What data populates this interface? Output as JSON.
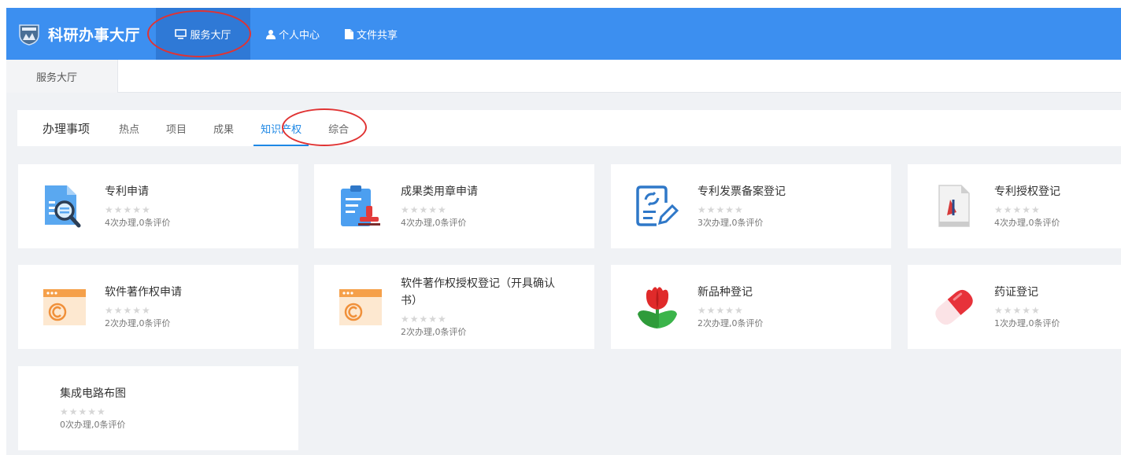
{
  "header": {
    "title": "科研办事大厅",
    "nav": [
      {
        "label": "服务大厅"
      },
      {
        "label": "个人中心"
      },
      {
        "label": "文件共享"
      }
    ]
  },
  "page_tab": {
    "label": "服务大厅"
  },
  "filter": {
    "heading": "办理事项",
    "items": [
      {
        "label": "热点"
      },
      {
        "label": "项目"
      },
      {
        "label": "成果"
      },
      {
        "label": "知识产权",
        "active": true
      },
      {
        "label": "综合"
      }
    ]
  },
  "cards": [
    {
      "title": "专利申请",
      "stats": "4次办理,0条评价",
      "rating": 0,
      "icon": "patent-search-icon"
    },
    {
      "title": "成果类用章申请",
      "stats": "4次办理,0条评价",
      "rating": 0,
      "icon": "clipboard-stamp-icon"
    },
    {
      "title": "专利发票备案登记",
      "stats": "3次办理,0条评价",
      "rating": 0,
      "icon": "invoice-edit-icon"
    },
    {
      "title": "专利授权登记",
      "stats": "4次办理,0条评价",
      "rating": 0,
      "icon": "pdf-document-icon"
    },
    {
      "title": "软件著作权申请",
      "stats": "2次办理,0条评价",
      "rating": 0,
      "icon": "copyright-window-icon"
    },
    {
      "title": "软件著作权授权登记（开具确认书）",
      "stats": "2次办理,0条评价",
      "rating": 0,
      "icon": "copyright-window-icon"
    },
    {
      "title": "新品种登记",
      "stats": "2次办理,0条评价",
      "rating": 0,
      "icon": "tulip-icon"
    },
    {
      "title": "药证登记",
      "stats": "1次办理,0条评价",
      "rating": 0,
      "icon": "capsule-icon"
    },
    {
      "title": "集成电路布图",
      "stats": "0次办理,0条评价",
      "rating": 0,
      "icon": ""
    }
  ],
  "stars_text": "★★★★★",
  "colors": {
    "navbar": "#3c8ff0",
    "nav_active": "#2f79d6",
    "accent": "#1e88e5",
    "annotation": "#e03333"
  }
}
